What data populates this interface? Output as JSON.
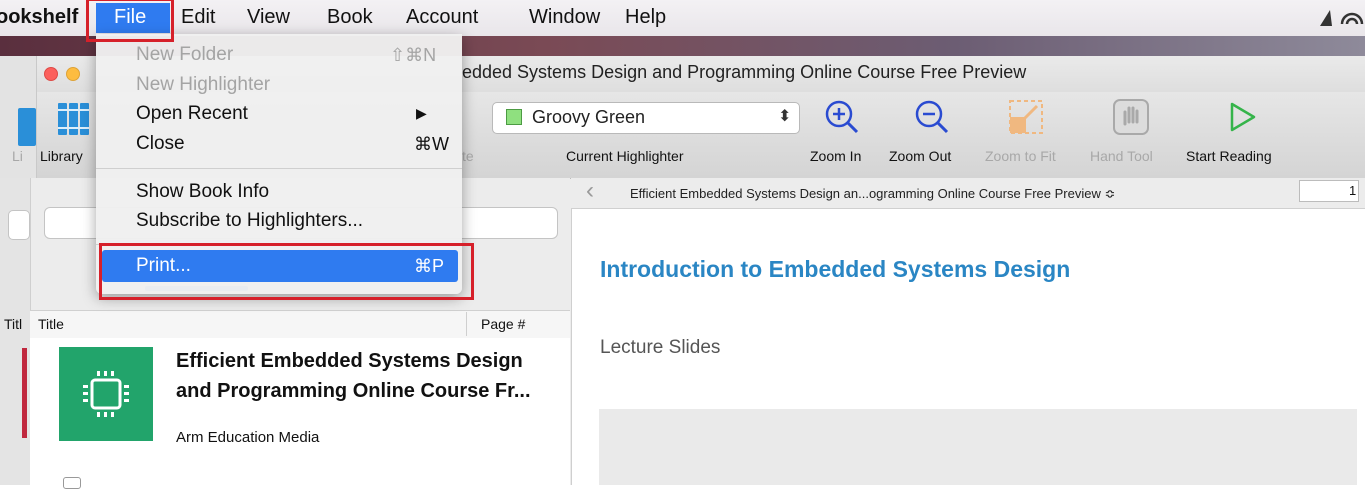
{
  "menubar": {
    "app": "ookshelf",
    "items": [
      "File",
      "Edit",
      "View",
      "Book",
      "Account",
      "Window",
      "Help"
    ]
  },
  "window": {
    "title": "edded Systems Design and Programming Online Course Free Preview"
  },
  "toolbar": {
    "back_library_label": "Li",
    "library_label": "Library",
    "partial_label": "te",
    "highlighter_value": "Groovy Green",
    "highlighter_label": "Current Highlighter",
    "zoom_in": "Zoom In",
    "zoom_out": "Zoom Out",
    "zoom_fit": "Zoom to Fit",
    "hand_tool": "Hand Tool",
    "start_reading": "Start Reading"
  },
  "file_menu": {
    "new_folder": "New Folder",
    "new_folder_shortcut": "⇧⌘N",
    "new_highlighter": "New Highlighter",
    "open_recent": "Open Recent",
    "open_recent_arrow": "▶",
    "close": "Close",
    "close_shortcut": "⌘W",
    "show_book_info": "Show Book Info",
    "subscribe": "Subscribe to Highlighters...",
    "print": "Print...",
    "print_shortcut": "⌘P"
  },
  "library": {
    "back_col_title": "Titl",
    "col_title": "Title",
    "col_page": "Page #",
    "book": {
      "title_line1": "Efficient Embedded Systems Design",
      "title_line2": "and Programming Online Course Fr...",
      "author": "Arm Education Media"
    }
  },
  "reader": {
    "nav_title": "Efficient Embedded Systems Design an...ogramming Online Course Free Preview ≎",
    "page": "1",
    "heading": "Introduction to Embedded Systems Design",
    "subheading": "Lecture Slides"
  },
  "colors": {
    "menu_highlight": "#2f7bf0",
    "annotation_red": "#d6202a",
    "heading_blue": "#2a86c4",
    "cover_green": "#22a46b",
    "highlighter_swatch": "#8fe07f"
  }
}
